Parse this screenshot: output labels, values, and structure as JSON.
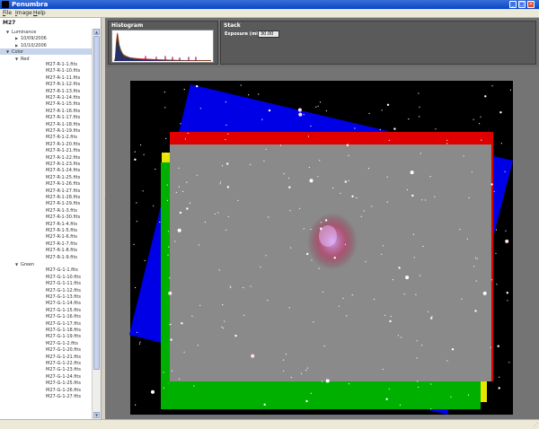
{
  "window": {
    "title": "Penumbra",
    "minimize": "_",
    "maximize": "□",
    "close": "×"
  },
  "menu": [
    {
      "label": "File",
      "hotkey": "F"
    },
    {
      "label": "Image",
      "hotkey": "I"
    },
    {
      "label": "Help",
      "hotkey": "H"
    }
  ],
  "sidebar": {
    "doc_title": "M27",
    "scroll_up": "▲",
    "scroll_down": "▼",
    "tree": [
      {
        "label": "Luminance",
        "depth": 1,
        "toggle": "expanded"
      },
      {
        "label": "10/09/2006",
        "depth": 2,
        "toggle": "collapsed"
      },
      {
        "label": "10/10/2006",
        "depth": 2,
        "toggle": "collapsed"
      },
      {
        "label": "Color",
        "depth": 1,
        "toggle": "expanded",
        "selected": true
      },
      {
        "label": "Red",
        "depth": 2,
        "toggle": "expanded"
      },
      {
        "label": "M27-R-1-1.fits",
        "depth": 3
      },
      {
        "label": "M27-R-1-10.fits",
        "depth": 3
      },
      {
        "label": "M27-R-1-11.fits",
        "depth": 3
      },
      {
        "label": "M27-R-1-12.fits",
        "depth": 3
      },
      {
        "label": "M27-R-1-13.fits",
        "depth": 3
      },
      {
        "label": "M27-R-1-14.fits",
        "depth": 3
      },
      {
        "label": "M27-R-1-15.fits",
        "depth": 3
      },
      {
        "label": "M27-R-1-16.fits",
        "depth": 3
      },
      {
        "label": "M27-R-1-17.fits",
        "depth": 3
      },
      {
        "label": "M27-R-1-18.fits",
        "depth": 3
      },
      {
        "label": "M27-R-1-19.fits",
        "depth": 3
      },
      {
        "label": "M27-R-1-2.fits",
        "depth": 3
      },
      {
        "label": "M27-R-1-20.fits",
        "depth": 3
      },
      {
        "label": "M27-R-1-21.fits",
        "depth": 3
      },
      {
        "label": "M27-R-1-22.fits",
        "depth": 3
      },
      {
        "label": "M27-R-1-23.fits",
        "depth": 3
      },
      {
        "label": "M27-R-1-24.fits",
        "depth": 3
      },
      {
        "label": "M27-R-1-25.fits",
        "depth": 3
      },
      {
        "label": "M27-R-1-26.fits",
        "depth": 3
      },
      {
        "label": "M27-R-1-27.fits",
        "depth": 3
      },
      {
        "label": "M27-R-1-28.fits",
        "depth": 3
      },
      {
        "label": "M27-R-1-29.fits",
        "depth": 3
      },
      {
        "label": "M27-R-1-3.fits",
        "depth": 3
      },
      {
        "label": "M27-R-1-30.fits",
        "depth": 3
      },
      {
        "label": "M27-R-1-4.fits",
        "depth": 3
      },
      {
        "label": "M27-R-1-5.fits",
        "depth": 3
      },
      {
        "label": "M27-R-1-6.fits",
        "depth": 3
      },
      {
        "label": "M27-R-1-7.fits",
        "depth": 3
      },
      {
        "label": "M27-R-1-8.fits",
        "depth": 3
      },
      {
        "label": "M27-R-1-9.fits",
        "depth": 3
      },
      {
        "label": "Green",
        "depth": 2,
        "toggle": "expanded"
      },
      {
        "label": "M27-G-1-1.fits",
        "depth": 3
      },
      {
        "label": "M27-G-1-10.fits",
        "depth": 3
      },
      {
        "label": "M27-G-1-11.fits",
        "depth": 3
      },
      {
        "label": "M27-G-1-12.fits",
        "depth": 3
      },
      {
        "label": "M27-G-1-13.fits",
        "depth": 3
      },
      {
        "label": "M27-G-1-14.fits",
        "depth": 3
      },
      {
        "label": "M27-G-1-15.fits",
        "depth": 3
      },
      {
        "label": "M27-G-1-16.fits",
        "depth": 3
      },
      {
        "label": "M27-G-1-17.fits",
        "depth": 3
      },
      {
        "label": "M27-G-1-18.fits",
        "depth": 3
      },
      {
        "label": "M27-G-1-19.fits",
        "depth": 3
      },
      {
        "label": "M27-G-1-2.fits",
        "depth": 3
      },
      {
        "label": "M27-G-1-20.fits",
        "depth": 3
      },
      {
        "label": "M27-G-1-21.fits",
        "depth": 3
      },
      {
        "label": "M27-G-1-22.fits",
        "depth": 3
      },
      {
        "label": "M27-G-1-23.fits",
        "depth": 3
      },
      {
        "label": "M27-G-1-24.fits",
        "depth": 3
      },
      {
        "label": "M27-G-1-25.fits",
        "depth": 3
      },
      {
        "label": "M27-G-1-26.fits",
        "depth": 3
      },
      {
        "label": "M27-G-1-27.fits",
        "depth": 3
      }
    ]
  },
  "histogram": {
    "title": "Histogram"
  },
  "stack": {
    "title": "Stack",
    "exposure_label": "Exposure (min.):",
    "exposure_value": "30.00"
  },
  "viewer": {
    "layers": [
      {
        "name": "blue",
        "color": "#0000ff"
      },
      {
        "name": "red",
        "color": "#ff0000"
      },
      {
        "name": "yellow",
        "color": "#ffff00"
      },
      {
        "name": "green",
        "color": "#00c000"
      }
    ]
  }
}
